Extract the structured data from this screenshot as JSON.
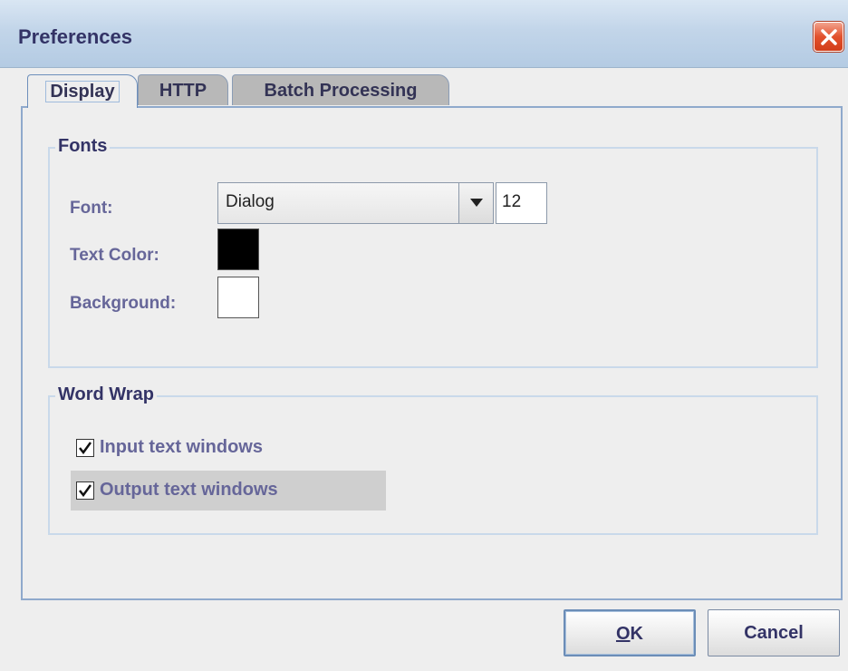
{
  "window": {
    "title": "Preferences"
  },
  "tabs": [
    {
      "label": "Display",
      "active": true
    },
    {
      "label": "HTTP",
      "active": false
    },
    {
      "label": "Batch Processing",
      "active": false
    }
  ],
  "fonts_group": {
    "title": "Fonts",
    "font_label": "Font:",
    "font_value": "Dialog",
    "font_size": "12",
    "text_color_label": "Text Color:",
    "text_color": "#000000",
    "background_label": "Background:",
    "background_color": "#ffffff"
  },
  "word_wrap_group": {
    "title": "Word Wrap",
    "items": [
      {
        "label": "Input text windows",
        "checked": true
      },
      {
        "label": "Output text windows",
        "checked": true
      }
    ]
  },
  "buttons": {
    "ok_label_mnemonic": "O",
    "ok_label_rest": "K",
    "cancel_label": "Cancel"
  },
  "icons": {
    "close": "close-icon",
    "dropdown": "chevron-down-icon",
    "check": "checkmark-icon"
  },
  "colors": {
    "title_text": "#333366",
    "label_text": "#666699",
    "close_button": "#e2512d",
    "tab_border": "#6d8fbb"
  }
}
